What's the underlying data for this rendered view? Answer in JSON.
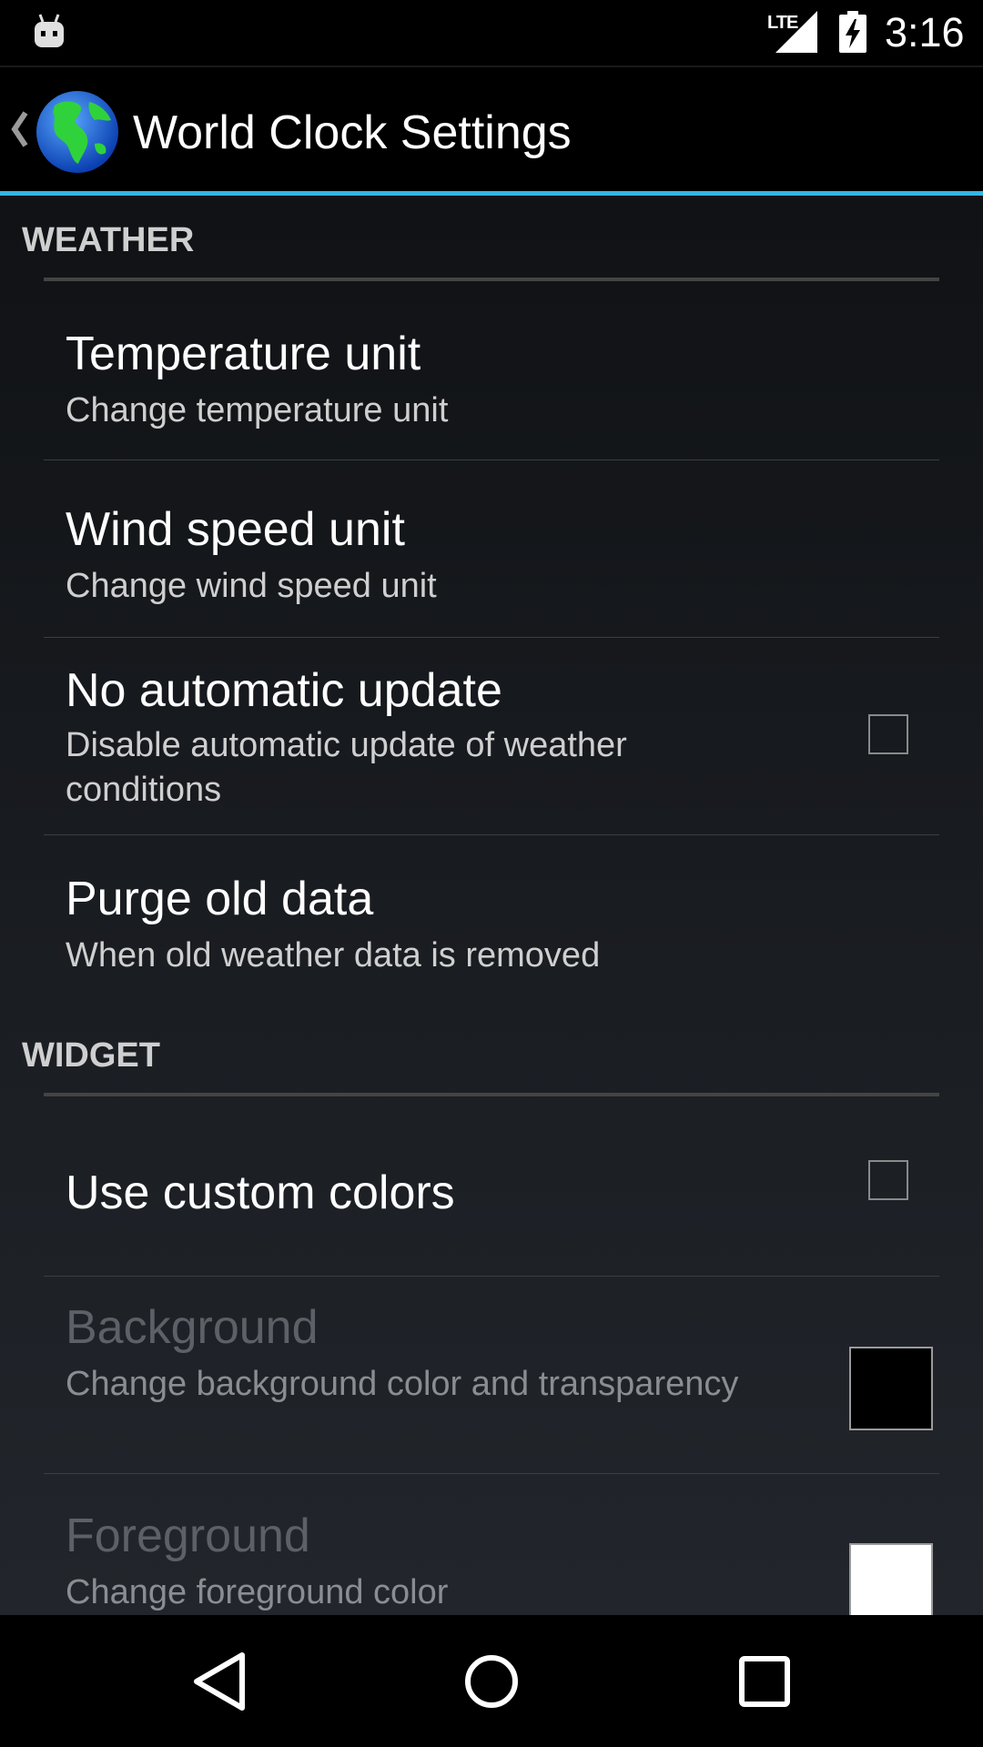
{
  "status_bar": {
    "network_label": "LTE",
    "time": "3:16"
  },
  "action_bar": {
    "title": "World Clock Settings"
  },
  "sections": {
    "weather": {
      "title": "WEATHER",
      "items": [
        {
          "title": "Temperature unit",
          "summary": "Change temperature unit"
        },
        {
          "title": "Wind speed unit",
          "summary": "Change wind speed unit"
        },
        {
          "title": "No automatic update",
          "summary": "Disable automatic update of weather conditions",
          "checked": false
        },
        {
          "title": "Purge old data",
          "summary": "When old weather data is removed"
        }
      ]
    },
    "widget": {
      "title": "WIDGET",
      "items": [
        {
          "title": "Use custom colors",
          "checked": false
        },
        {
          "title": "Background",
          "summary": "Change background color and transparency",
          "color": "#000000",
          "enabled": false
        },
        {
          "title": "Foreground",
          "summary": "Change foreground color",
          "color": "#ffffff",
          "enabled": false
        }
      ]
    }
  },
  "colors": {
    "accent": "#33b5e5",
    "background_top": "#101215",
    "background_bottom": "#22262c"
  },
  "icons": {
    "status": [
      "android-debug-icon",
      "signal-icon",
      "battery-charging-icon"
    ],
    "action_bar": [
      "back-caret-icon",
      "globe-app-icon"
    ],
    "nav": [
      "back-nav-icon",
      "home-nav-icon",
      "recents-nav-icon"
    ]
  }
}
